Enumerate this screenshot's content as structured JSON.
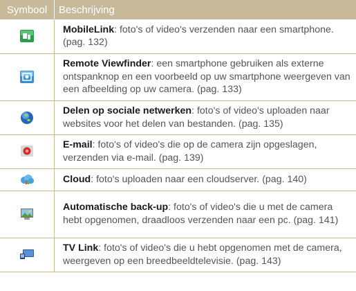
{
  "header": {
    "symbol": "Symbool",
    "description": "Beschrijving"
  },
  "rows": [
    {
      "icon": "mobilelink-icon",
      "title": "MobileLink",
      "text": ": foto's of video's verzenden naar een smartphone. (pag. 132)"
    },
    {
      "icon": "remote-viewfinder-icon",
      "title": "Remote Viewfinder",
      "text": ": een smartphone gebruiken als externe ontspanknop en een voorbeeld op uw smartphone weergeven van een afbeelding op uw camera. (pag. 133)"
    },
    {
      "icon": "social-network-globe-icon",
      "title": "Delen op sociale netwerken",
      "text": ": foto's of video's uploaden naar websites voor het delen van bestanden. (pag. 135)"
    },
    {
      "icon": "email-icon",
      "title": "E-mail",
      "text": ": foto's of video's die op de camera zijn opgeslagen, verzenden via e-mail. (pag. 139)"
    },
    {
      "icon": "cloud-icon",
      "title": "Cloud",
      "text": ": foto's uploaden naar een cloudserver. (pag. 140)"
    },
    {
      "icon": "auto-backup-icon",
      "title": "Automatische back-up",
      "text": ": foto's of video's die u met de camera hebt opgenomen, draadloos verzenden naar een pc. (pag. 141)"
    },
    {
      "icon": "tv-link-icon",
      "title": "TV Link",
      "text": ": foto's of video's die u hebt opgenomen met de camera, weergeven op een breedbeeldtelevisie. (pag. 143)"
    }
  ]
}
